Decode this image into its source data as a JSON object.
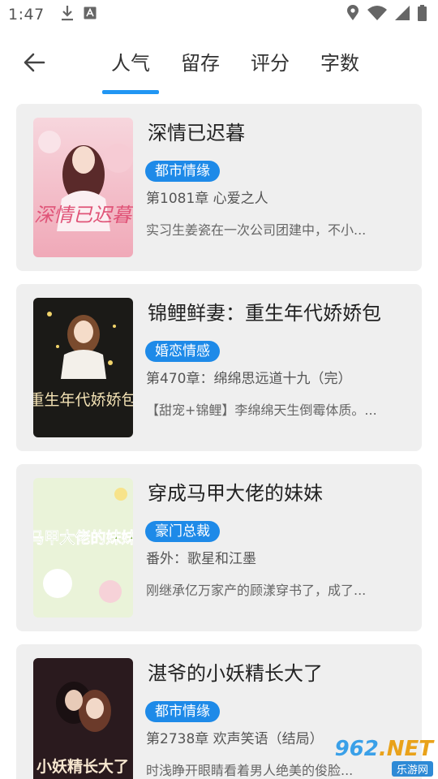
{
  "status_bar": {
    "time": "1:47",
    "icons": [
      "download-icon",
      "sim-notification-icon",
      "location-icon",
      "wifi-icon",
      "signal-icon",
      "battery-icon"
    ]
  },
  "header": {
    "back_icon": "back-arrow-icon",
    "tabs": [
      {
        "label": "人气",
        "active": true
      },
      {
        "label": "留存",
        "active": false
      },
      {
        "label": "评分",
        "active": false
      },
      {
        "label": "字数",
        "active": false
      }
    ],
    "accent_color": "#2196f3"
  },
  "books": [
    {
      "title": "深情已迟暮",
      "tag": "都市情缘",
      "chapter": "第1081章 心爱之人",
      "description": "实习生姜瓷在一次公司团建中，不小...",
      "cover_text": "深情已迟暮"
    },
    {
      "title": "锦鲤鲜妻：重生年代娇娇包",
      "tag": "婚恋情感",
      "chapter": "第470章：绵绵思远道十九（完）",
      "description": "【甜宠+锦鲤】李绵绵天生倒霉体质。...",
      "cover_text": "重生年代娇娇包"
    },
    {
      "title": "穿成马甲大佬的妹妹",
      "tag": "豪门总裁",
      "chapter": "番外：歌星和江墨",
      "description": "刚继承亿万家产的顾漾穿书了，成了...",
      "cover_text": "马甲大佬的妹妹"
    },
    {
      "title": "湛爷的小妖精长大了",
      "tag": "都市情缘",
      "chapter": "第2738章 欢声笑语（结局）",
      "description": "时浅睁开眼睛看着男人绝美的俊脸...",
      "cover_text": "小妖精长大了"
    }
  ],
  "watermark": {
    "number": "962",
    "domain": ".NET",
    "subtitle": "乐游网"
  }
}
